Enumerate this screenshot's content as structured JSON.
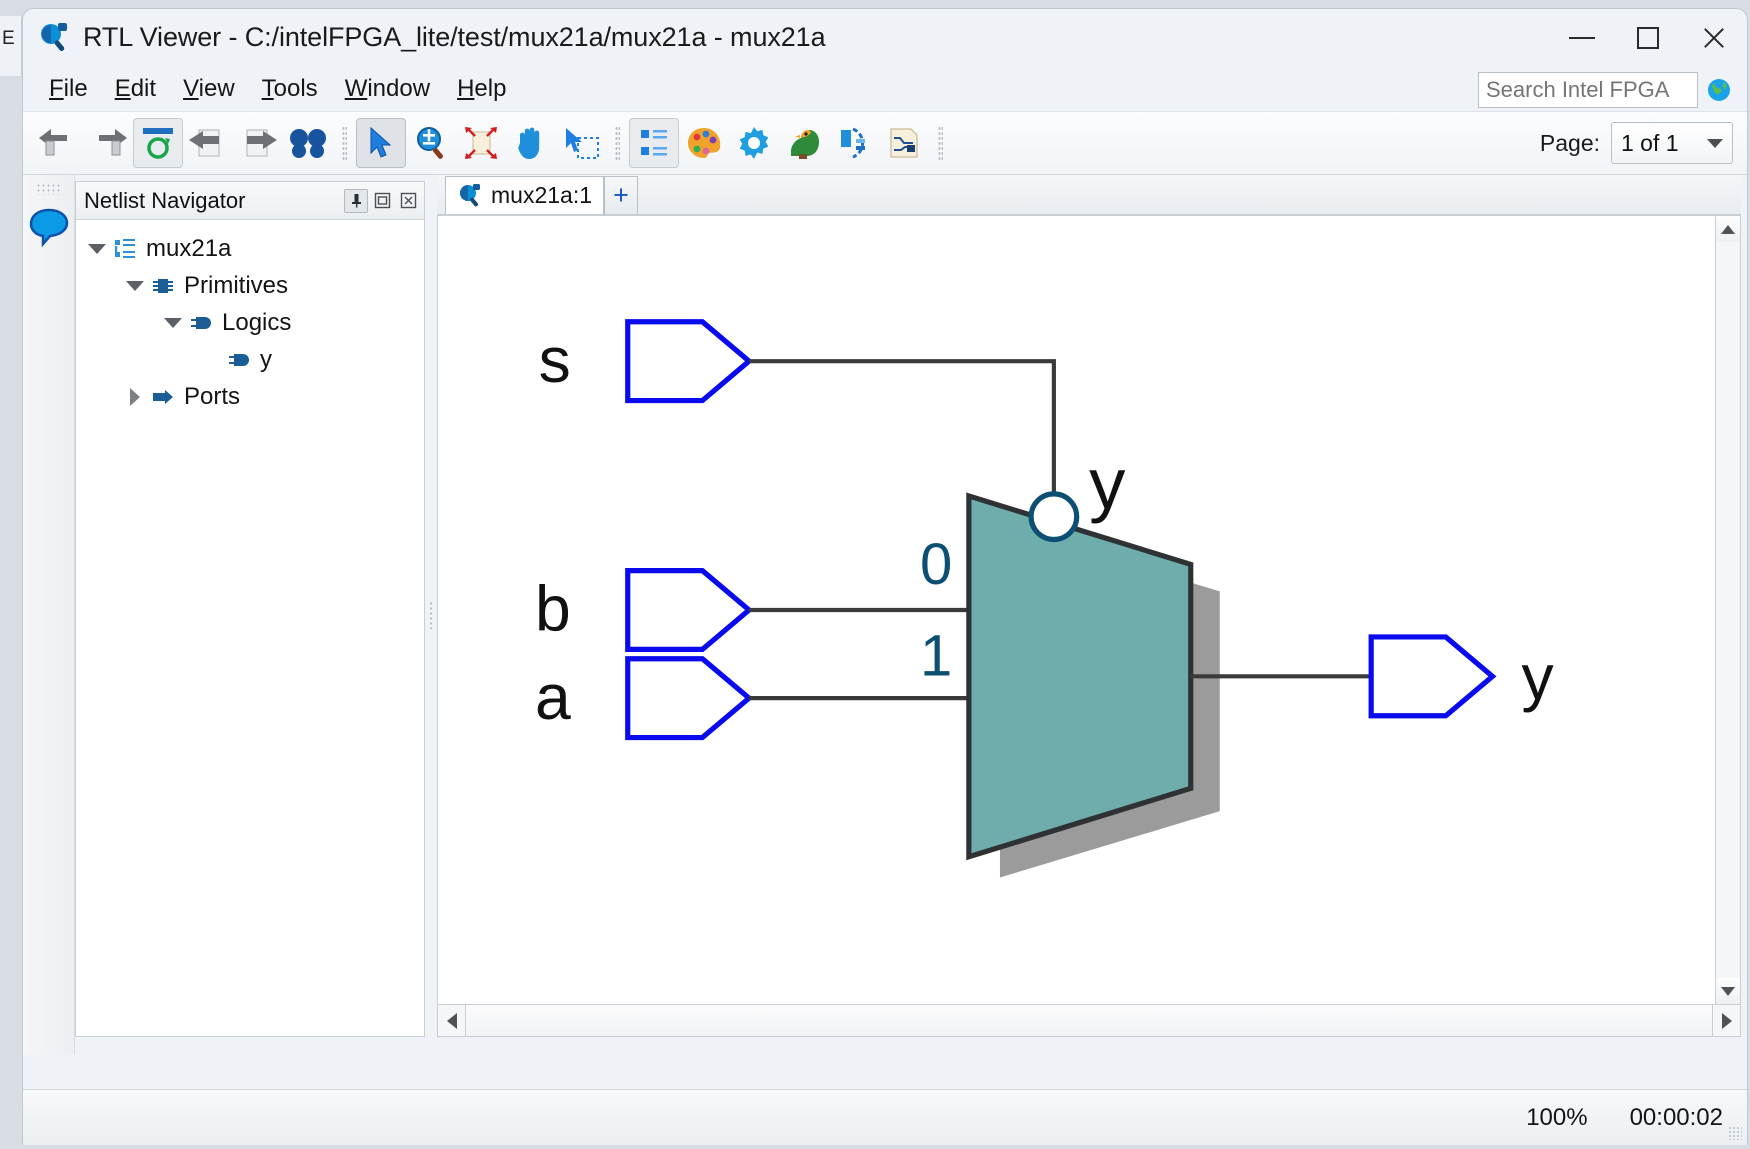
{
  "window": {
    "title": "RTL Viewer - C:/intelFPGA_lite/test/mux21a/mux21a - mux21a",
    "app_icon": "rtl-viewer-icon",
    "minimize_label": "—",
    "maximize_label": "□",
    "close_label": "✕",
    "behind_sliver_text": "E"
  },
  "menu": {
    "items": [
      {
        "label": "File",
        "accel": "F"
      },
      {
        "label": "Edit",
        "accel": "E"
      },
      {
        "label": "View",
        "accel": "V"
      },
      {
        "label": "Tools",
        "accel": "T"
      },
      {
        "label": "Window",
        "accel": "W"
      },
      {
        "label": "Help",
        "accel": "H"
      }
    ]
  },
  "search": {
    "placeholder": "Search Intel FPGA",
    "value": "",
    "globe_icon": "globe-icon"
  },
  "toolbar": {
    "buttons": [
      {
        "name": "back-icon",
        "group": 1
      },
      {
        "name": "forward-icon",
        "group": 1
      },
      {
        "name": "refresh-icon",
        "group": 1,
        "framed": true
      },
      {
        "name": "previous-page-icon",
        "group": 1
      },
      {
        "name": "next-page-icon",
        "group": 1
      },
      {
        "name": "find-icon",
        "group": 1
      },
      {
        "name": "select-tool-icon",
        "group": 2,
        "active": true
      },
      {
        "name": "zoom-tool-icon",
        "group": 2
      },
      {
        "name": "fit-page-icon",
        "group": 2
      },
      {
        "name": "hand-pan-icon",
        "group": 2
      },
      {
        "name": "area-select-icon",
        "group": 2
      },
      {
        "name": "hierarchy-icon",
        "group": 3,
        "framed": true
      },
      {
        "name": "color-palette-icon",
        "group": 3
      },
      {
        "name": "settings-gear-icon",
        "group": 3
      },
      {
        "name": "bird-view-icon",
        "group": 3
      },
      {
        "name": "highlight-fanin-icon",
        "group": 3
      },
      {
        "name": "schematic-page-icon",
        "group": 3
      }
    ],
    "page_label": "Page:",
    "page_value": "1 of 1",
    "page_caret": "chevron-down-icon"
  },
  "dock": {
    "items": [
      {
        "name": "messages-bubble-icon",
        "color": "#0b9ae6"
      }
    ]
  },
  "netlist_navigator": {
    "title": "Netlist Navigator",
    "header_buttons": [
      {
        "name": "pin-panel-icon",
        "glyph": "⚐"
      },
      {
        "name": "float-panel-icon",
        "glyph": "⧉"
      },
      {
        "name": "close-panel-icon",
        "glyph": "✕"
      }
    ],
    "tree": [
      {
        "label": "mux21a",
        "depth": 0,
        "expanded": true,
        "icon": "hierarchy-node-icon"
      },
      {
        "label": "Primitives",
        "depth": 1,
        "expanded": true,
        "icon": "primitives-chip-icon"
      },
      {
        "label": "Logics",
        "depth": 2,
        "expanded": true,
        "icon": "logic-plug-icon"
      },
      {
        "label": "y",
        "depth": 3,
        "expanded": null,
        "icon": "logic-plug-icon"
      },
      {
        "label": "Ports",
        "depth": 1,
        "expanded": false,
        "icon": "ports-arrow-icon"
      }
    ]
  },
  "document_tabs": {
    "tabs": [
      {
        "label": "mux21a:1",
        "icon": "rtl-viewer-icon",
        "active": true
      }
    ],
    "add_label": "+"
  },
  "schematic": {
    "colors": {
      "port_outline": "#0a0aee",
      "wire": "#3a3a3a",
      "mux_fill": "#6fadad",
      "mux_outline": "#2e3234",
      "mux_shadow": "#9b9b9b",
      "pin_label": "#0d4f72",
      "port_label": "#111111"
    },
    "input_ports": [
      {
        "name": "s",
        "label": "s"
      },
      {
        "name": "b",
        "label": "b"
      },
      {
        "name": "a",
        "label": "a"
      }
    ],
    "output_ports": [
      {
        "name": "y",
        "label": "y"
      }
    ],
    "mux": {
      "instance_label": "y",
      "data_pins": [
        "0",
        "1"
      ],
      "select_inverted": true
    }
  },
  "status_bar": {
    "zoom": "100%",
    "elapsed_time": "00:00:02"
  }
}
